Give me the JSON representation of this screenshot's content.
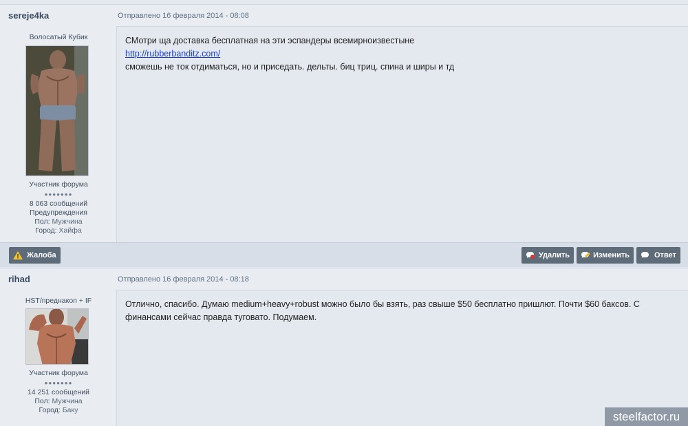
{
  "posts": [
    {
      "username": "sereje4ka",
      "posted": "Отправлено 16 февраля 2014 - 08:08",
      "title": "Волосатый Кубик",
      "rank": "Участник форума",
      "pips": "●●●●●●●",
      "posts_count": "8 063 сообщений",
      "warnings": "Предупреждения",
      "gender_label": "Пол:",
      "gender": "Мужчина",
      "city_label": "Город:",
      "city": "Хайфа",
      "lines": [
        "СМотри ща доставка бесплатная на эти эспандеры всемирноизвестыне",
        "http://rubberbanditz.com/",
        "сможешь не ток отдиматься, но и приседать. дельты. биц триц. спина и ширы и тд"
      ]
    },
    {
      "username": "rihad",
      "posted": "Отправлено 16 февраля 2014 - 08:18",
      "title": "HST/преднакоп + IF",
      "rank": "Участник форума",
      "pips": "●●●●●●●",
      "posts_count": "14 251 сообщений",
      "gender_label": "Пол:",
      "gender": "Мужчина",
      "city_label": "Город:",
      "city": "Баку",
      "lines": [
        "Отлично, спасибо. Думаю medium+heavy+robust можно было бы взять, раз свыше $50 бесплатно пришлют. Почти $60 баксов. С",
        "финансами сейчас правда туговато. Подумаем."
      ]
    }
  ],
  "actions": {
    "report": "Жалоба",
    "delete": "Удалить",
    "edit": "Изменить",
    "reply": "Ответ"
  },
  "watermark": "steelfactor.ru",
  "colors": {
    "button_bg": "#5e6b79",
    "link": "#1a3ec8",
    "header_bg": "#e9edf2"
  }
}
